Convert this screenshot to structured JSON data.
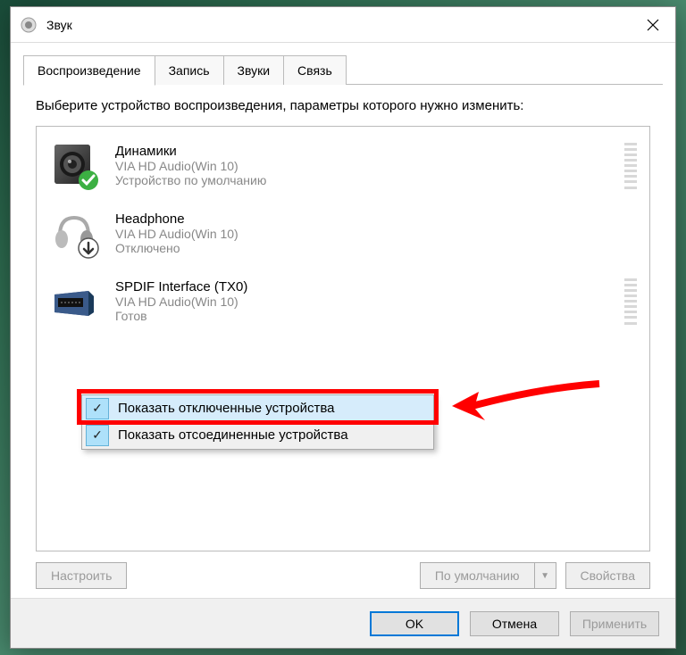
{
  "window": {
    "title": "Звук"
  },
  "tabs": [
    {
      "label": "Воспроизведение",
      "active": true
    },
    {
      "label": "Запись",
      "active": false
    },
    {
      "label": "Звуки",
      "active": false
    },
    {
      "label": "Связь",
      "active": false
    }
  ],
  "instruction": "Выберите устройство воспроизведения, параметры которого нужно изменить:",
  "devices": [
    {
      "name": "Динамики",
      "driver": "VIA HD Audio(Win 10)",
      "status": "Устройство по умолчанию",
      "icon": "speaker",
      "badge": "check-green"
    },
    {
      "name": "Headphone",
      "driver": "VIA HD Audio(Win 10)",
      "status": "Отключено",
      "icon": "headphone",
      "badge": "arrow-down"
    },
    {
      "name": "SPDIF Interface (TX0)",
      "driver": "VIA HD Audio(Win 10)",
      "status": "Готов",
      "icon": "spdif",
      "badge": null
    }
  ],
  "context_menu": [
    {
      "label": "Показать отключенные устройства",
      "checked": true,
      "highlighted": true
    },
    {
      "label": "Показать отсоединенные устройства",
      "checked": true,
      "highlighted": false
    }
  ],
  "buttons": {
    "configure": "Настроить",
    "default": "По умолчанию",
    "properties": "Свойства",
    "ok": "OK",
    "cancel": "Отмена",
    "apply": "Применить"
  }
}
